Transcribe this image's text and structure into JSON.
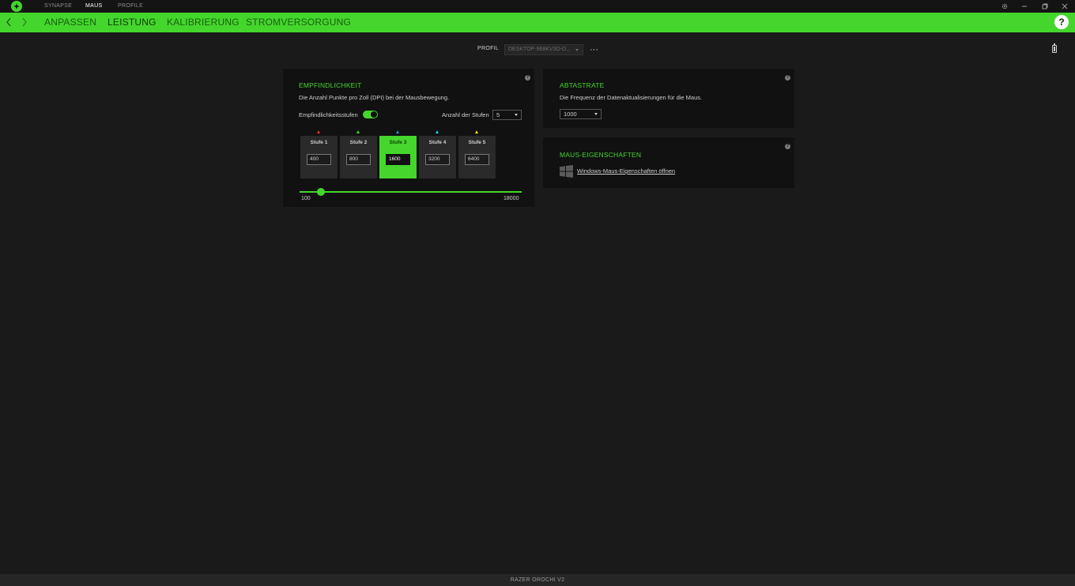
{
  "titlebar": {
    "nav": [
      {
        "label": "SYNAPSE",
        "active": false
      },
      {
        "label": "MAUS",
        "active": true
      },
      {
        "label": "PROFILE",
        "active": false
      }
    ],
    "controls": [
      "settings-icon",
      "minimize-icon",
      "restore-icon",
      "close-icon"
    ]
  },
  "subnav": {
    "tabs": [
      {
        "label": "ANPASSEN",
        "active": false
      },
      {
        "label": "LEISTUNG",
        "active": true
      },
      {
        "label": "KALIBRIERUNG",
        "active": false
      },
      {
        "label": "STROMVERSORGUNG",
        "active": false
      }
    ],
    "help": "?",
    "accent": "#44d62c"
  },
  "profile": {
    "label": "PROFIL",
    "value": "DESKTOP-968KV3D-D...",
    "more": "···"
  },
  "sensitivity": {
    "title": "EMPFINDLICHKEIT",
    "description": "Die Anzahl Punkte pro Zoll (DPI) bei der Mausbewegung.",
    "stages_toggle_label": "Empfindlichkeitsstufen",
    "stages_toggle_on": true,
    "stage_count_label": "Anzahl der Stufen",
    "stage_count": "5",
    "stages": [
      {
        "label": "Stufe 1",
        "value": "400",
        "color": "#e8322f",
        "active": false
      },
      {
        "label": "Stufe 2",
        "value": "800",
        "color": "#44d62c",
        "active": false
      },
      {
        "label": "Stufe 3",
        "value": "1600",
        "color": "#2b8fe8",
        "active": true
      },
      {
        "label": "Stufe 4",
        "value": "3200",
        "color": "#2bc8e8",
        "active": false
      },
      {
        "label": "Stufe 5",
        "value": "6400",
        "color": "#e8e22b",
        "active": false
      }
    ],
    "slider_min": "100",
    "slider_max": "18000",
    "slider_value": 1600
  },
  "polling": {
    "title": "ABTASTRATE",
    "description": "Die Frequenz der Datenaktualisierungen für die Maus.",
    "value": "1000"
  },
  "mouse_props": {
    "title": "MAUS-EIGENSCHAFTEN",
    "link": "Windows-Maus-Eigenschaften öffnen"
  },
  "footer": {
    "device": "RAZER OROCHI V2"
  }
}
